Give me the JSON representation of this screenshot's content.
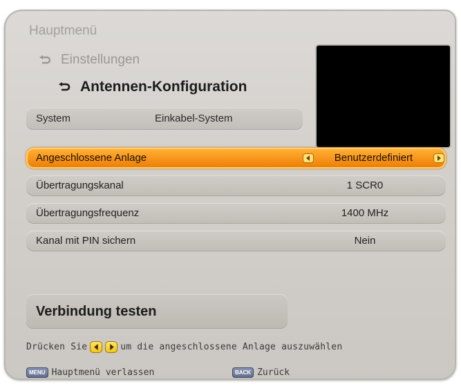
{
  "breadcrumb": {
    "main": "Hauptmenü",
    "settings": "Einstellungen",
    "current": "Antennen-Konfiguration"
  },
  "system": {
    "label": "System",
    "value": "Einkabel-System"
  },
  "rows": [
    {
      "label": "Angeschlossene Anlage",
      "value": "Benutzerdefiniert",
      "selected": true
    },
    {
      "label": "Übertragungskanal",
      "value": "1 SCR0",
      "selected": false
    },
    {
      "label": "Übertragungsfrequenz",
      "value": "1400 MHz",
      "selected": false
    },
    {
      "label": "Kanal mit PIN sichern",
      "value": "Nein",
      "selected": false
    }
  ],
  "test_button": "Verbindung testen",
  "hint": {
    "before": "Drücken Sie",
    "after": "um die angeschlossene Anlage auszuwählen"
  },
  "footer": {
    "menu_key": "MENU",
    "menu_label": "Hauptmenü verlassen",
    "back_key": "BACK",
    "back_label": "Zurück"
  },
  "colors": {
    "selected_row": "#f79418",
    "panel": "#d3d0cc",
    "preview": "#000000"
  },
  "icons": [
    "return-arrow-icon",
    "left-arrow-icon",
    "right-arrow-icon"
  ]
}
